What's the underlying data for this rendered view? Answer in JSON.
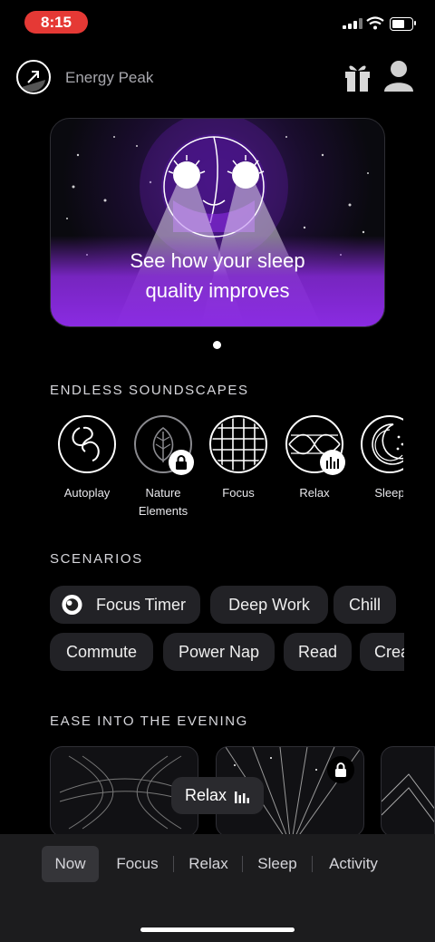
{
  "status_bar": {
    "time": "8:15"
  },
  "header": {
    "brand": "Energy Peak",
    "icons": [
      "gift-icon",
      "profile-icon"
    ]
  },
  "hero": {
    "text_line1": "See how your sleep",
    "text_line2": "quality improves"
  },
  "sections": {
    "soundscapes_title": "ENDLESS SOUNDSCAPES",
    "scenarios_title": "SCENARIOS",
    "evening_title": "EASE INTO THE EVENING"
  },
  "soundscapes": [
    {
      "label": "Autoplay",
      "locked": false
    },
    {
      "label_line1": "Nature",
      "label_line2": "Elements",
      "locked": true
    },
    {
      "label": "Focus",
      "locked": false
    },
    {
      "label": "Relax",
      "locked": false,
      "playing": true
    },
    {
      "label": "Sleep",
      "locked": false
    }
  ],
  "scenarios": [
    "Focus Timer",
    "Deep Work",
    "Chill",
    "Commute",
    "Power Nap",
    "Read",
    "Create"
  ],
  "mini_player": {
    "label": "Relax"
  },
  "tabs": [
    "Now",
    "Focus",
    "Relax",
    "Sleep",
    "Activity"
  ],
  "active_tab": "Now",
  "colors": {
    "hero_purple": "#8a2be2",
    "status_red": "#e53935"
  }
}
